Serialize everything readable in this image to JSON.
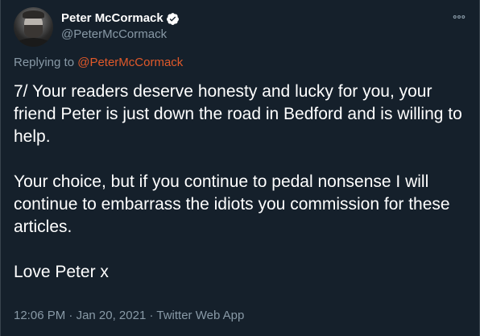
{
  "author": {
    "display_name": "Peter McCormack",
    "handle": "@PeterMcCormack",
    "verified": true
  },
  "more_icon": "more-horizontal-icon",
  "reply": {
    "prefix": "Replying to ",
    "mention": "@PeterMcCormack"
  },
  "tweet": {
    "paragraphs": [
      "7/ Your readers deserve honesty and lucky for you, your friend Peter is just down the road in Bedford and is willing to help.",
      "Your choice, but if you continue to pedal nonsense I will continue to embarrass the idiots you commission for these articles.",
      "Love Peter x"
    ]
  },
  "meta": {
    "time": "12:06 PM",
    "date": "Jan 20, 2021",
    "source": "Twitter Web App",
    "separator": " · "
  },
  "colors": {
    "background": "#15202b",
    "text": "#ffffff",
    "secondary": "#8899a6",
    "mention": "#e0592a",
    "verified": "#ffffff"
  }
}
